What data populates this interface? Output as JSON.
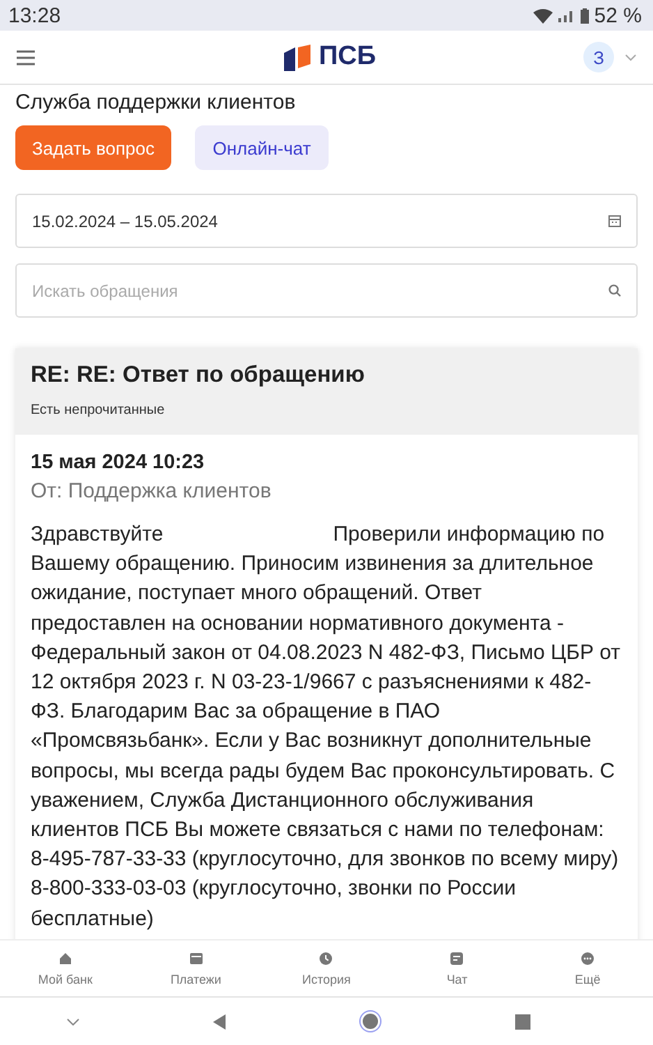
{
  "status_bar": {
    "time": "13:28",
    "battery": "52 %"
  },
  "header": {
    "logo_text": "ПСБ",
    "avatar": "З"
  },
  "page": {
    "title": "Служба поддержки клиентов",
    "buttons": [
      {
        "label": "Задать вопрос",
        "kind": "primary"
      },
      {
        "label": "Онлайн-чат",
        "kind": "secondary"
      }
    ]
  },
  "date_range": {
    "value": "15.02.2024 – 15.05.2024"
  },
  "search": {
    "placeholder": "Искать обращения"
  },
  "thread": {
    "subject": "RE: RE: Ответ по обращению",
    "status": "Есть непрочитанные",
    "message": {
      "date": "15 мая 2024 10:23",
      "from": "От: Поддержка клиентов",
      "greeting": "Здравствуйте",
      "text": "Проверили информацию по Вашему обращению. Приносим извинения за длительное ожидание, поступает много обращений. Ответ предоставлен на основании нормативного документа - Федеральный закон от 04.08.2023 N 482-ФЗ, Письмо ЦБР от 12 октября 2023 г. N 03-23-1/9667 с разъяснениями к 482-ФЗ. Благодарим Вас за обращение в ПАО «Промсвязьбанк». Если у Вас возникнут дополнительные вопросы, мы всегда рады будем Вас проконсультировать. С уважением, Служба Дистанционного обслуживания клиентов ПСБ Вы можете связаться с нами по телефонам: 8-495-787-33-33 (круглосуточно, для звонков по всему миру) 8-800-333-03-03 (круглосуточно, звонки по России бесплатные)"
    }
  },
  "bottom_nav": [
    {
      "label": "Мой банк",
      "kind": "home"
    },
    {
      "label": "Платежи",
      "kind": "card"
    },
    {
      "label": "История",
      "kind": "clock"
    },
    {
      "label": "Чат",
      "kind": "chat"
    },
    {
      "label": "Ещё",
      "kind": "more"
    }
  ]
}
